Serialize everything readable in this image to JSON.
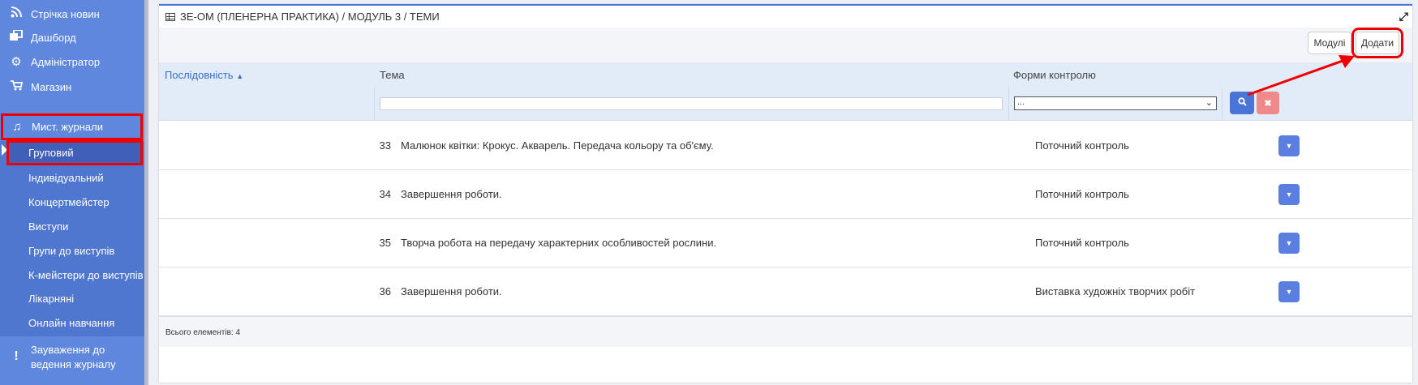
{
  "sidebar": {
    "items": [
      {
        "label": "Стрічка новин",
        "icon": "rss-icon"
      },
      {
        "label": "Дашборд",
        "icon": "dashboard-icon"
      },
      {
        "label": "Адміністратор",
        "icon": "gear-icon"
      },
      {
        "label": "Магазин",
        "icon": "cart-icon"
      },
      {
        "label": "Мист. журнали",
        "icon": "music-icon"
      }
    ],
    "subitems": [
      "Груповий",
      "Індивідуальний",
      "Концертмейстер",
      "Виступи",
      "Групи до виступів",
      "К-мейстери до виступів",
      "Лікарняні",
      "Онлайн навчання"
    ],
    "note": {
      "label": "Зауваження до ведення журналу",
      "icon": "exclamation-icon"
    }
  },
  "panel": {
    "title": "ЗЕ-ОМ (ПЛЕНЕРНА ПРАКТИКА) / МОДУЛЬ 3 / ТЕМИ",
    "buttons": {
      "modules": "Модулі",
      "add": "Додати"
    },
    "columns": {
      "sequence": "Послідовність",
      "topic": "Тема",
      "control": "Форми контролю"
    },
    "filters": {
      "control_select_value": "..."
    },
    "rows": [
      {
        "num": "33",
        "topic": "Малюнок квітки: Крокус. Акварель. Передача кольору та об'єму.",
        "control": "Поточний контроль"
      },
      {
        "num": "34",
        "topic": "Завершення роботи.",
        "control": "Поточний контроль"
      },
      {
        "num": "35",
        "topic": "Творча робота на передачу характерних особливостей рослини.",
        "control": "Поточний контроль"
      },
      {
        "num": "36",
        "topic": "Завершення роботи.",
        "control": "Виставка художніх творчих робіт"
      }
    ],
    "footer": "Всього елементів: 4"
  },
  "colors": {
    "sidebar": "#5f87de",
    "accent": "#4a74d8",
    "highlight": "#e00000",
    "clear_button": "#f08a8a"
  }
}
